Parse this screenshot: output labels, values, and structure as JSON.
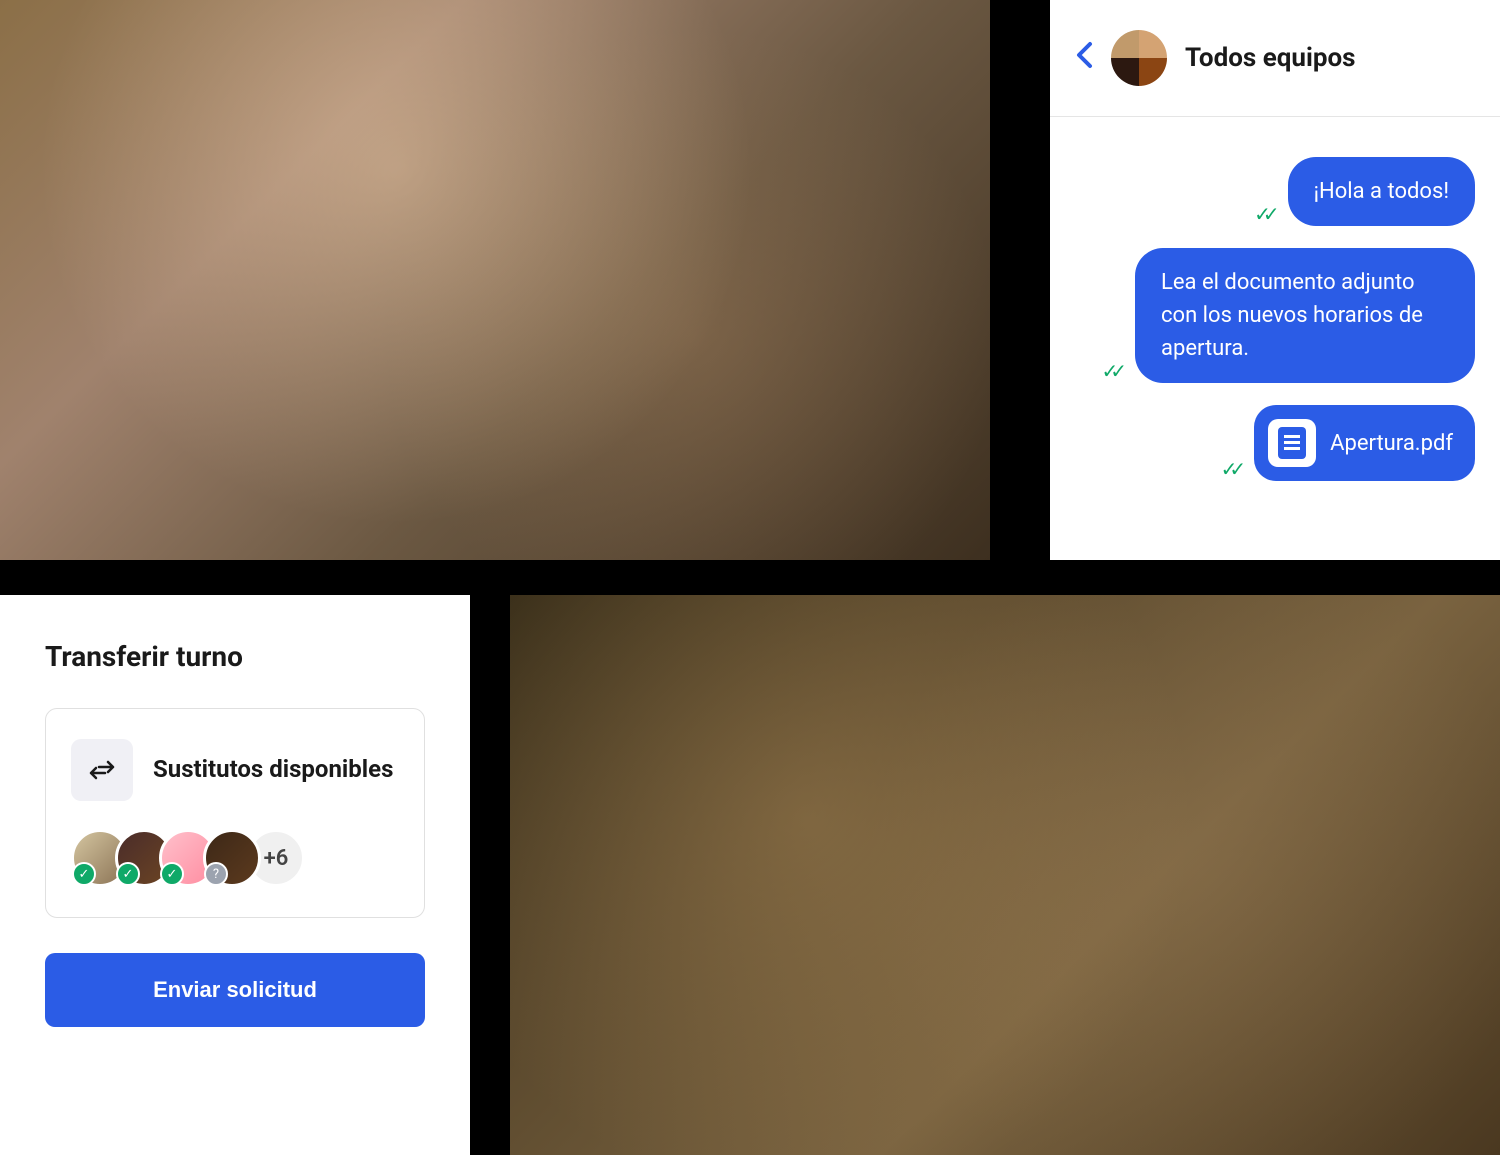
{
  "chat": {
    "title": "Todos equipos",
    "messages": [
      {
        "text": "¡Hola a todos!"
      },
      {
        "text": "Lea el documento adjunto con los nuevos horarios de apertura."
      }
    ],
    "attachment": {
      "filename": "Apertura.pdf"
    }
  },
  "transfer": {
    "title": "Transferir turno",
    "substitutes_label": "Sustitutos disponibles",
    "avatars": [
      {
        "status": "check"
      },
      {
        "status": "check"
      },
      {
        "status": "check"
      },
      {
        "status": "question"
      }
    ],
    "more_count": "+6",
    "send_button": "Enviar solicitud"
  },
  "colors": {
    "primary": "#2b5ce6",
    "success": "#0fa968"
  }
}
